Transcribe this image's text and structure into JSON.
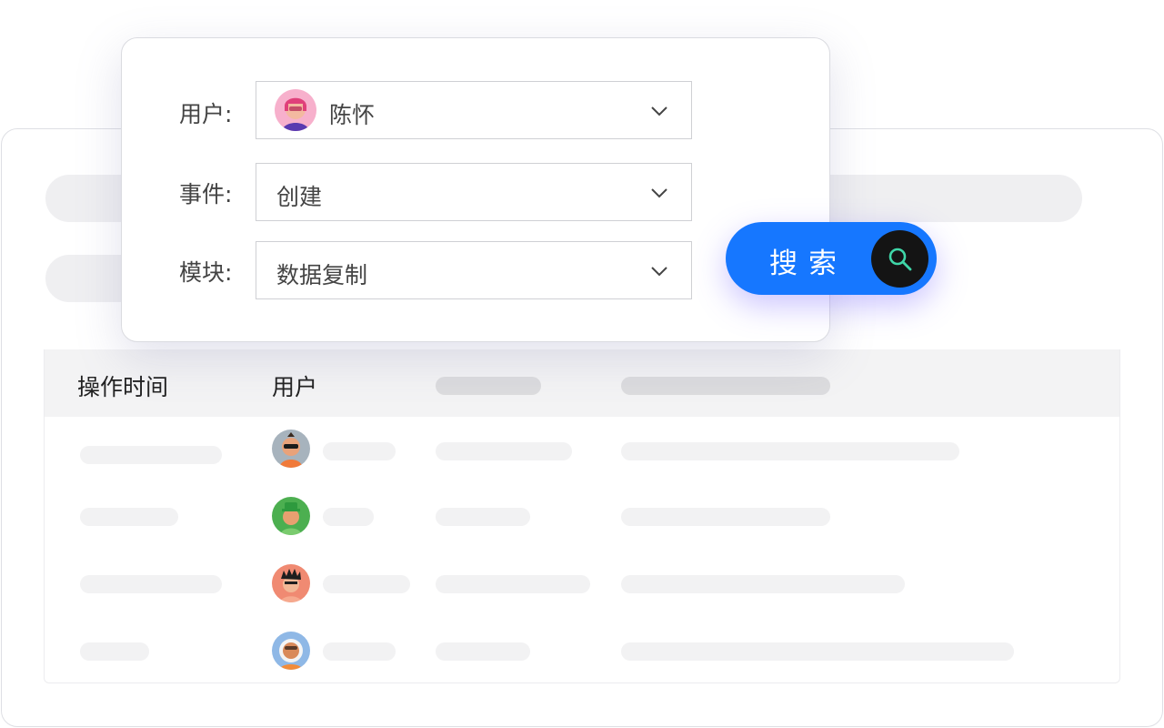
{
  "filter": {
    "user_label": "用户:",
    "user_value": "陈怀",
    "event_label": "事件:",
    "event_value": "创建",
    "module_label": "模块:",
    "module_value": "数据复制"
  },
  "search": {
    "label": "搜索",
    "icon": "search-icon",
    "button_color": "#1677ff"
  },
  "table": {
    "columns": [
      "操作时间",
      "用户"
    ],
    "rows": [
      {
        "avatar": "avatar-sunglasses"
      },
      {
        "avatar": "avatar-green-hat"
      },
      {
        "avatar": "avatar-spiky-hair"
      },
      {
        "avatar": "avatar-astronaut"
      }
    ]
  },
  "colors": {
    "accent": "#1677ff",
    "skeleton": "#f2f2f3",
    "header_bg": "#f3f3f4"
  }
}
